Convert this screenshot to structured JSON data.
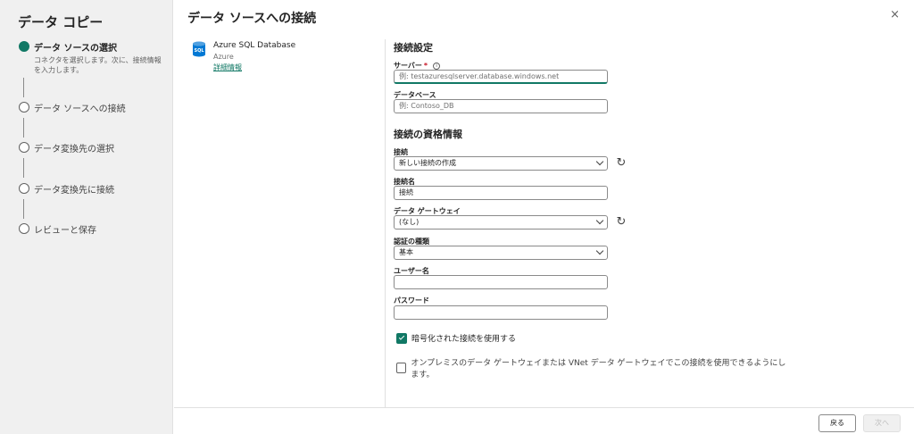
{
  "sidebar": {
    "title": "データ コピー",
    "steps": [
      {
        "label": "データ ソースの選択",
        "desc": "コネクタを選択します。次に、接続情報を入力します。",
        "active": true
      },
      {
        "label": "データ ソースへの接続"
      },
      {
        "label": "データ変換先の選択"
      },
      {
        "label": "データ変換先に接続"
      },
      {
        "label": "レビューと保存"
      }
    ]
  },
  "dialog": {
    "title": "データ ソースへの接続",
    "close": "×"
  },
  "source": {
    "icon_text": "SQL",
    "name": "Azure SQL Database",
    "sub": "Azure",
    "link": "詳細情報"
  },
  "settings": {
    "section_title": "接続設定",
    "server_label": "サーバー",
    "server_required": "*",
    "info_glyph": "i",
    "server_placeholder": "例: testazuresqlserver.database.windows.net",
    "database_label": "データベース",
    "database_placeholder": "例: Contoso_DB"
  },
  "credentials": {
    "section_title": "接続の資格情報",
    "connection_label": "接続",
    "connection_value": "新しい接続の作成",
    "connection_name_label": "接続名",
    "connection_name_value": "接続",
    "gateway_label": "データ ゲートウェイ",
    "gateway_value": "(なし)",
    "auth_label": "認証の種類",
    "auth_value": "基本",
    "username_label": "ユーザー名",
    "password_label": "パスワード",
    "refresh_glyph": "↻"
  },
  "options": {
    "encrypted_label": "暗号化された接続を使用する",
    "encrypted_checked": true,
    "onprem_label": "オンプレミスのデータ ゲートウェイまたは VNet データ ゲートウェイでこの接続を使用できるようにします。",
    "onprem_checked": false
  },
  "footer": {
    "back": "戻る",
    "next": "次へ"
  }
}
